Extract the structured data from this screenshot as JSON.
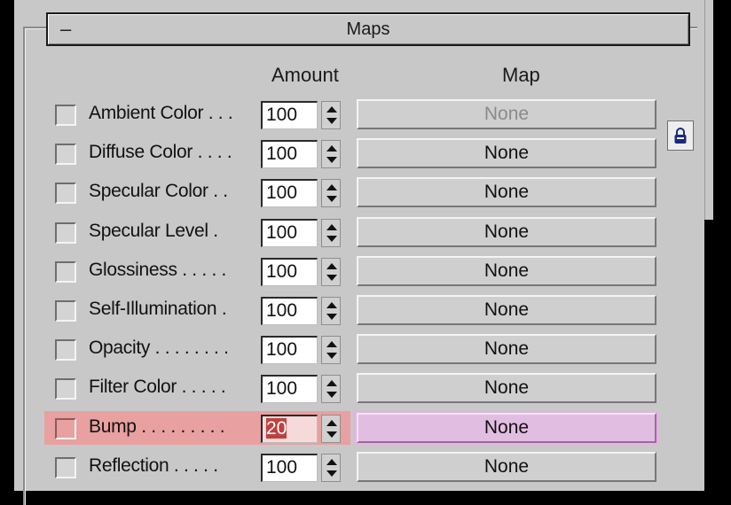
{
  "rollout": {
    "collapse_symbol": "–",
    "title": "Maps"
  },
  "columns": {
    "amount": "Amount",
    "map": "Map"
  },
  "rows": [
    {
      "label": "Ambient Color . . .",
      "amount": "100",
      "map": "None",
      "map_disabled": true
    },
    {
      "label": "Diffuse Color . . . .",
      "amount": "100",
      "map": "None"
    },
    {
      "label": "Specular Color  . .",
      "amount": "100",
      "map": "None"
    },
    {
      "label": "Specular Level  .",
      "amount": "100",
      "map": "None"
    },
    {
      "label": "Glossiness  . . . . .",
      "amount": "100",
      "map": "None"
    },
    {
      "label": "Self-Illumination .",
      "amount": "100",
      "map": "None"
    },
    {
      "label": "Opacity . . . . . . . .",
      "amount": "100",
      "map": "None"
    },
    {
      "label": "Filter Color  . . . . .",
      "amount": "100",
      "map": "None"
    },
    {
      "label": "Bump  . . . . . . . . .",
      "amount": "20",
      "map": "None",
      "highlighted": true
    },
    {
      "label": "Reflection  . . . . .",
      "amount": "100",
      "map": "None"
    }
  ],
  "icons": {
    "lock": "lock-icon",
    "spinner_up": "spinner-up-icon",
    "spinner_down": "spinner-down-icon"
  },
  "colors": {
    "highlight_left": "#e8a0a0",
    "highlight_right": "#e0b6e0",
    "panel": "#c8c8c8"
  }
}
